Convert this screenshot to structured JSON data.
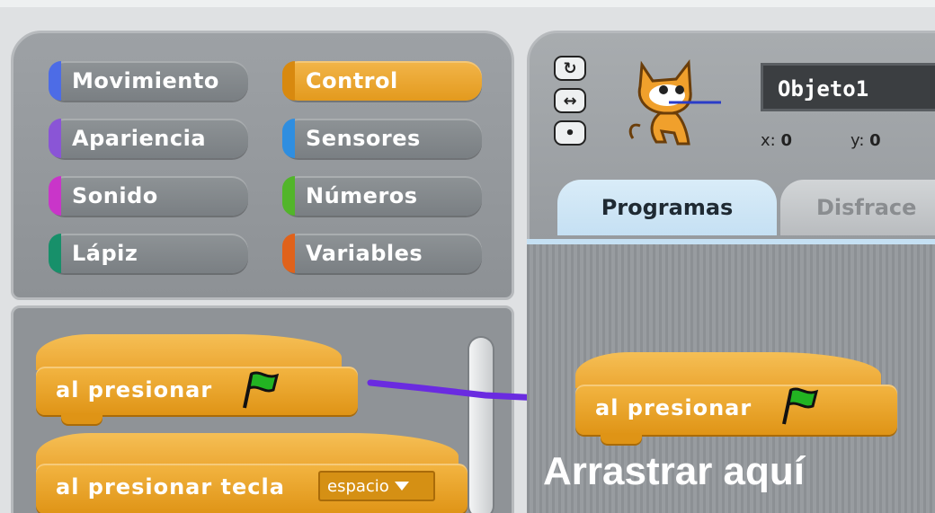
{
  "categories": [
    {
      "label": "Movimiento",
      "color": "#4d6ce6"
    },
    {
      "label": "Control",
      "color": "#e89d1c",
      "active": true
    },
    {
      "label": "Apariencia",
      "color": "#8a55d6"
    },
    {
      "label": "Sensores",
      "color": "#2f8ee0"
    },
    {
      "label": "Sonido",
      "color": "#c935c9"
    },
    {
      "label": "Números",
      "color": "#52b52a"
    },
    {
      "label": "Lápiz",
      "color": "#17906a"
    },
    {
      "label": "Variables",
      "color": "#e0621b"
    }
  ],
  "palette": {
    "block1_label": "al presionar",
    "block2_label": "al presionar tecla",
    "block2_dropdown": "espacio"
  },
  "sprite": {
    "name": "Objeto1",
    "x_label": "x:",
    "x_value": "0",
    "y_label": "y:",
    "y_value": "0"
  },
  "tabs": {
    "programs": "Programas",
    "costumes": "Disfrace"
  },
  "script": {
    "block_label": "al presionar",
    "drop_hint": "Arrastrar aquí"
  },
  "colors": {
    "control": "#e89d1c",
    "arrow": "#6a2be0",
    "flag": "#22b422"
  }
}
